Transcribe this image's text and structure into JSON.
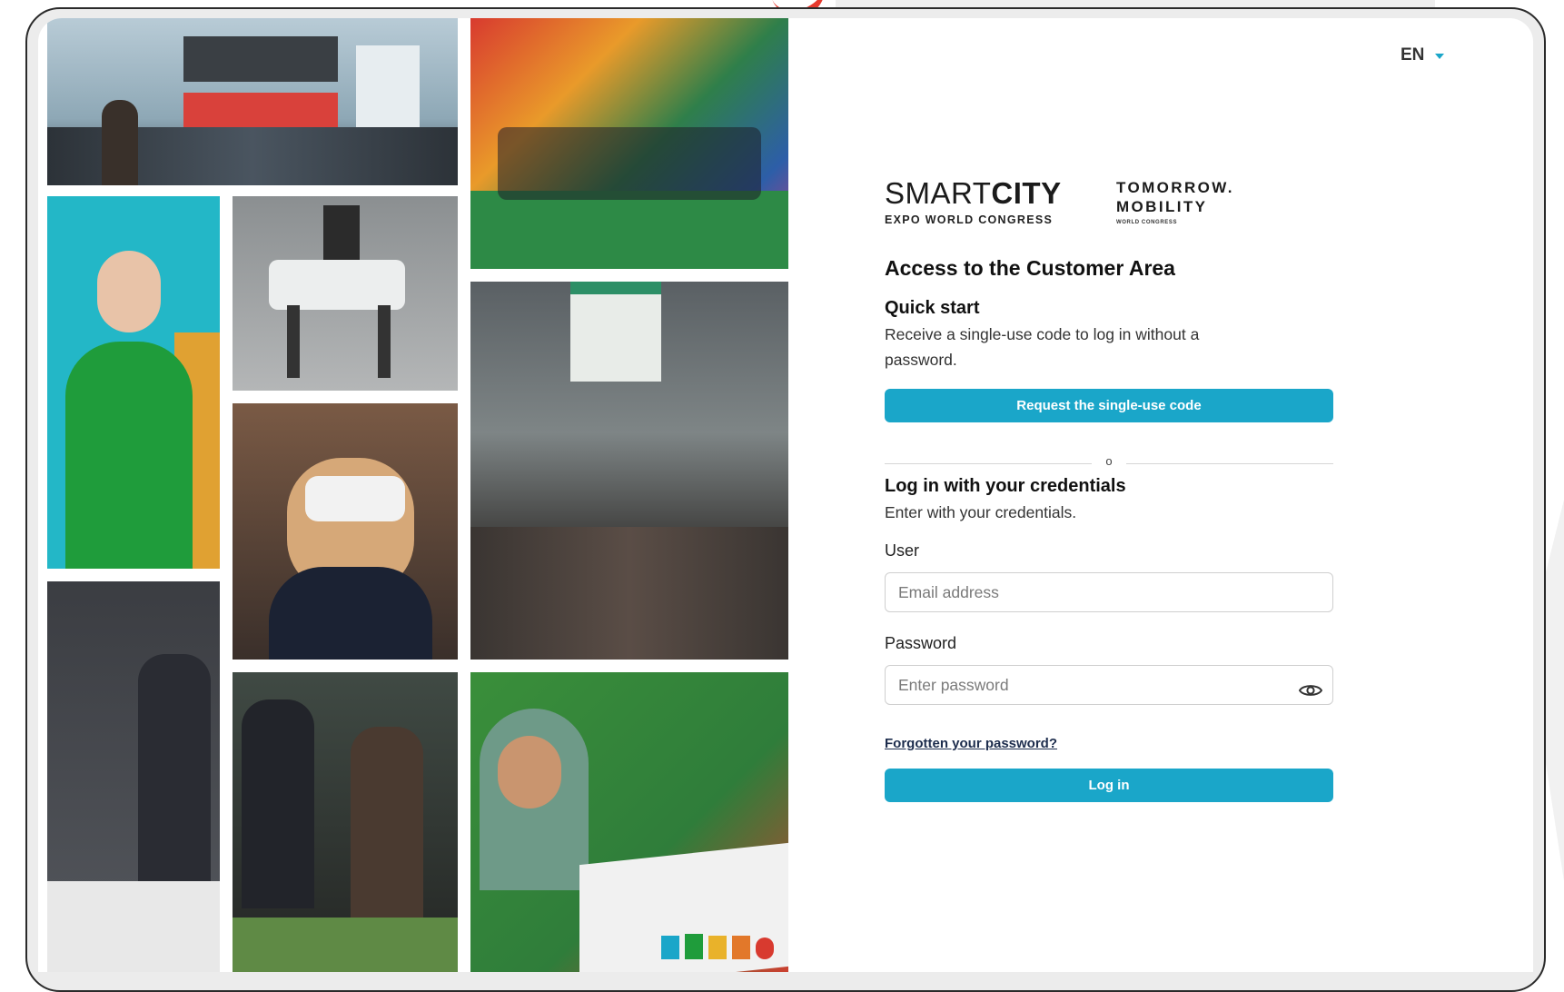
{
  "language": {
    "selected": "EN",
    "icon": "chevron-down-icon"
  },
  "brand": {
    "smartcity_light": "SMART",
    "smartcity_bold": "CITY",
    "smartcity_subtitle": "EXPO WORLD CONGRESS",
    "tomorrow_line1": "TOMORROW.",
    "tomorrow_line2": "MOBILITY",
    "tomorrow_subtitle": "WORLD CONGRESS"
  },
  "login": {
    "title": "Access to the Customer Area",
    "quick_start": {
      "heading": "Quick start",
      "description": "Receive a single-use code to log in without a password.",
      "button": "Request the single-use code"
    },
    "divider_text": "o",
    "credentials": {
      "heading": "Log in with your credentials",
      "description": "Enter with your credentials.",
      "user_label": "User",
      "user_placeholder": "Email address",
      "user_value": "",
      "password_label": "Password",
      "password_placeholder": "Enter password",
      "password_value": "",
      "password_icon": "eye-icon",
      "forgot_link": "Forgotten your password?",
      "submit_button": "Log in"
    }
  },
  "colors": {
    "accent": "#1aa6c9",
    "heading": "#111111",
    "link": "#1d2d4d"
  }
}
